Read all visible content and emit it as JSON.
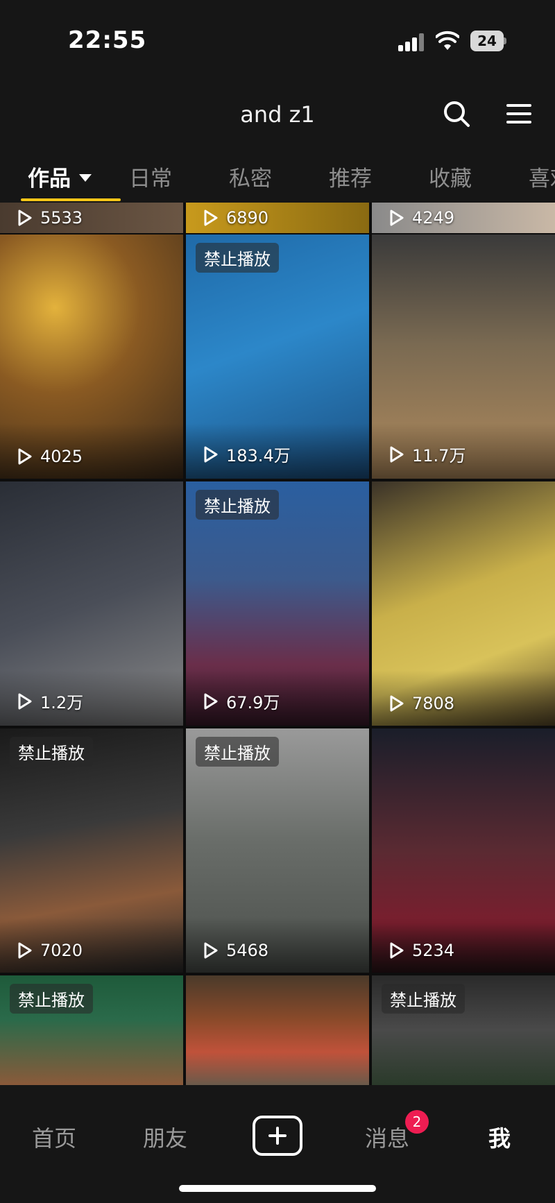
{
  "status_bar": {
    "time": "22:55",
    "battery": "24"
  },
  "header": {
    "title": "and z1",
    "search_icon": "search-icon",
    "menu_icon": "menu-icon"
  },
  "tabs": [
    {
      "label": "作品",
      "active": true
    },
    {
      "label": "日常"
    },
    {
      "label": "私密"
    },
    {
      "label": "推荐"
    },
    {
      "label": "收藏"
    },
    {
      "label": "喜欢"
    }
  ],
  "grid": {
    "top_row": [
      {
        "views": "5533"
      },
      {
        "views": "6890"
      },
      {
        "views": "4249"
      }
    ],
    "items": [
      {
        "views": "4025",
        "badge": ""
      },
      {
        "views": "183.4万",
        "badge": "禁止播放"
      },
      {
        "views": "11.7万",
        "badge": ""
      },
      {
        "views": "1.2万",
        "badge": ""
      },
      {
        "views": "67.9万",
        "badge": "禁止播放"
      },
      {
        "views": "7808",
        "badge": ""
      },
      {
        "views": "7020",
        "badge": "禁止播放"
      },
      {
        "views": "5468",
        "badge": "禁止播放"
      },
      {
        "views": "5234",
        "badge": ""
      },
      {
        "views": "",
        "badge": "禁止播放"
      },
      {
        "views": "",
        "badge": ""
      },
      {
        "views": "",
        "badge": "禁止播放"
      }
    ]
  },
  "bottom_nav": {
    "home": "首页",
    "friends": "朋友",
    "messages": "消息",
    "messages_badge": "2",
    "me": "我"
  },
  "colors": {
    "accent": "#f5c518",
    "badge_red": "#ee1d52",
    "background": "#161616"
  }
}
